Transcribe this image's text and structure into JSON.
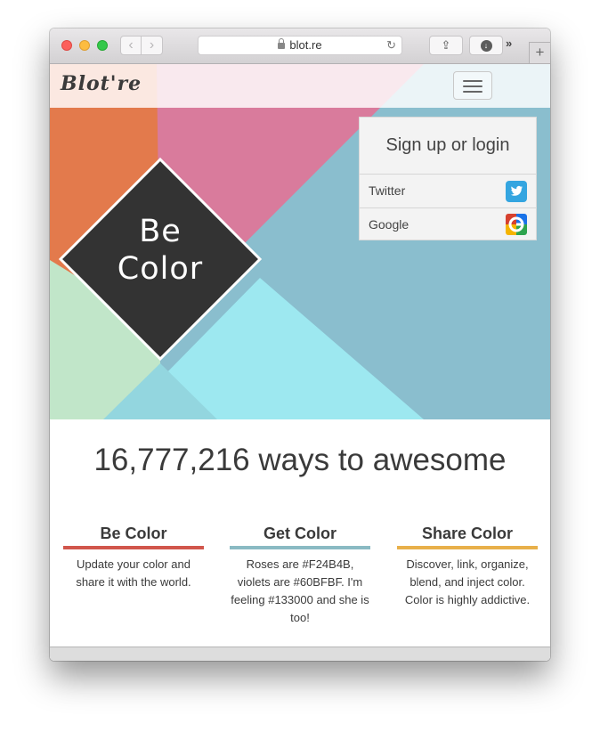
{
  "browser": {
    "url": "blot.re",
    "back_label": "‹",
    "forward_label": "›",
    "reload_icon": "↻",
    "share_icon": "⇪",
    "download_icon": "↓",
    "overflow_label": "»",
    "new_tab_label": "+"
  },
  "site": {
    "logo": "Blot're",
    "hero_tagline": "Be Color",
    "login": {
      "title": "Sign up or login",
      "providers": [
        {
          "label": "Twitter",
          "icon": "twitter-icon"
        },
        {
          "label": "Google",
          "icon": "google-icon"
        }
      ]
    },
    "headline": "16,777,216 ways to awesome",
    "features": [
      {
        "title": "Be Color",
        "text": "Update your color and share it with the world.",
        "color": "#D1564C"
      },
      {
        "title": "Get Color",
        "text": "Roses are #F24B4B, violets are #60BFBF. I'm feeling #133000 and she is too!",
        "color": "#8ABAC3"
      },
      {
        "title": "Share Color",
        "text": "Discover, link, organize, blend, and inject color. Color is highly addictive.",
        "color": "#E8B04A"
      }
    ]
  },
  "colors": {
    "orange": "#E37A4C",
    "pink": "#D97B9C",
    "blue": "#8ABECE",
    "cyan": "#9DE8F0",
    "mint": "#C1E6C9",
    "dark": "#333333"
  }
}
